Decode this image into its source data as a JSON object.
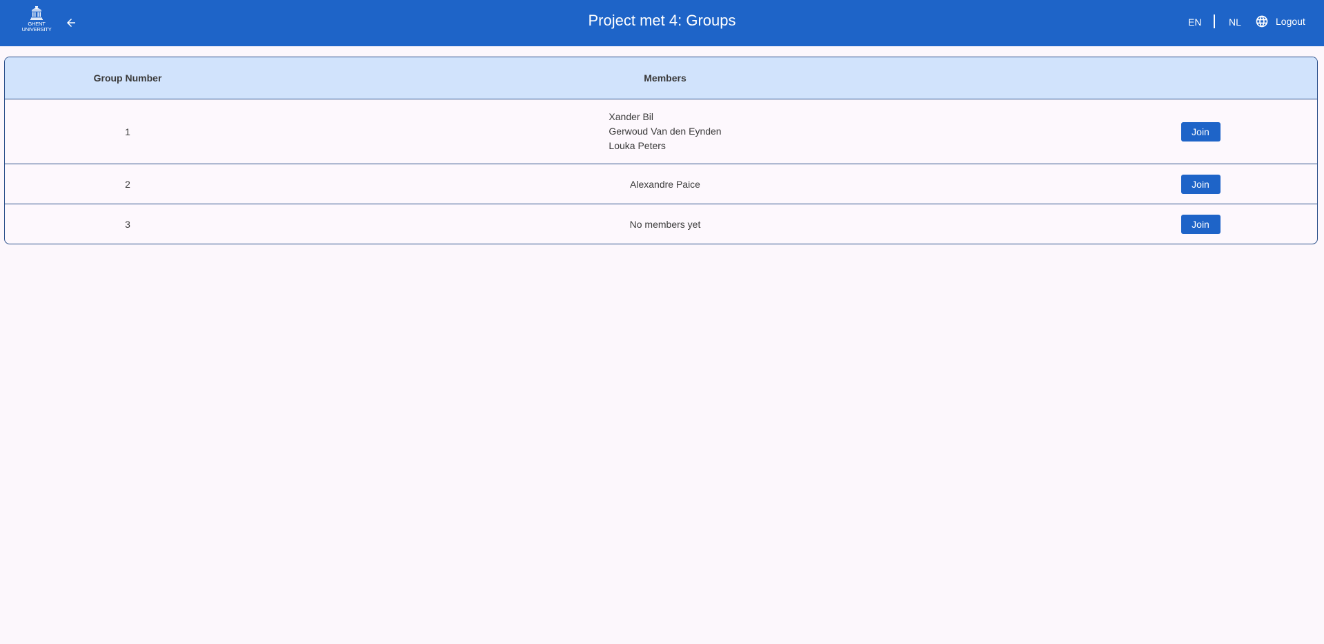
{
  "header": {
    "logo_text_line1": "GHENT",
    "logo_text_line2": "UNIVERSITY",
    "back_icon": "arrow-left-icon",
    "title": "Project met 4: Groups",
    "lang_en": "EN",
    "lang_nl": "NL",
    "logout_icon": "globe-icon",
    "logout_label": "Logout",
    "color": "#1e64c8"
  },
  "table": {
    "columns": [
      "Group Number",
      "Members",
      ""
    ],
    "header_color": "#d1e3fc",
    "rows": [
      {
        "group": "1",
        "members": [
          "Xander Bil",
          "Gerwoud Van den Eynden",
          "Louka Peters"
        ],
        "action": "Join"
      },
      {
        "group": "2",
        "members": [
          "Alexandre Paice"
        ],
        "action": "Join"
      },
      {
        "group": "3",
        "members": [
          "No members yet"
        ],
        "action": "Join"
      }
    ]
  }
}
